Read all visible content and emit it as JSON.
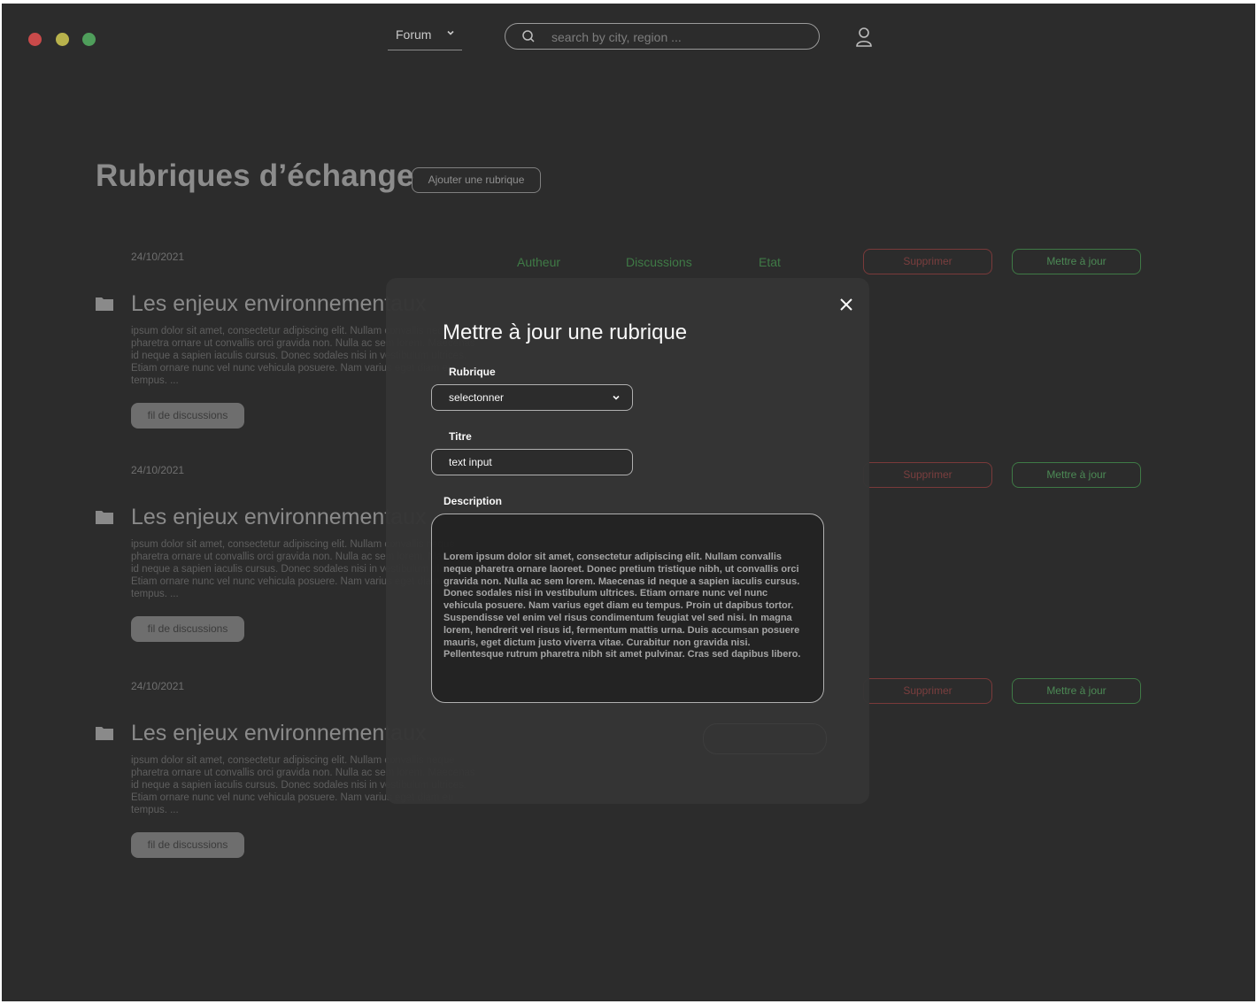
{
  "window": {
    "controls": [
      "close",
      "minimize",
      "maximize"
    ]
  },
  "nav": {
    "forum_label": "Forum",
    "search_placeholder": "search by city, region ...",
    "icons": {
      "search": "search-icon",
      "user": "user-icon",
      "chevron": "chevron-down-icon"
    }
  },
  "header": {
    "title": "Rubriques d’échange",
    "add_button": "Ajouter une rubrique"
  },
  "columns": {
    "author": "Autheur",
    "discussions": "Discussions",
    "state": "Etat"
  },
  "topics": [
    {
      "date": "24/10/2021",
      "title": "Les enjeux environnementaux",
      "description": "ipsum dolor sit amet, consectetur adipiscing elit. Nullam convallis neque pharetra ornare ut convallis orci gravida non. Nulla ac sem lorem. Maecenas id neque a sapien iaculis cursus. Donec sodales nisi in vestibulum ultrices. Etiam ornare nunc vel nunc vehicula posuere. Nam varius eget diam eu tempus. ...",
      "thread_button": "fil de discussions",
      "delete_button": "Supprimer",
      "update_button": "Mettre à jour"
    },
    {
      "date": "24/10/2021",
      "title": "Les enjeux environnementaux",
      "description": "ipsum dolor sit amet, consectetur adipiscing elit. Nullam convallis neque pharetra ornare ut convallis orci gravida non. Nulla ac sem lorem. Maecenas id neque a sapien iaculis cursus. Donec sodales nisi in vestibulum ultrices. Etiam ornare nunc vel nunc vehicula posuere. Nam varius eget diam eu tempus. ...",
      "thread_button": "fil de discussions",
      "delete_button": "Supprimer",
      "update_button": "Mettre à jour"
    },
    {
      "date": "24/10/2021",
      "title": "Les enjeux environnementaux",
      "description": "ipsum dolor sit amet, consectetur adipiscing elit. Nullam convallis neque pharetra ornare ut convallis orci gravida non. Nulla ac sem lorem. Maecenas id neque a sapien iaculis cursus. Donec sodales nisi in vestibulum ultrices. Etiam ornare nunc vel nunc vehicula posuere. Nam varius eget diam eu tempus. ...",
      "thread_button": "fil de discussions",
      "delete_button": "Supprimer",
      "update_button": "Mettre à jour"
    }
  ],
  "modal": {
    "title": "Mettre à jour une rubrique",
    "rubrique_label": "Rubrique",
    "rubrique_value": "selectonner",
    "titre_label": "Titre",
    "titre_value": "text input",
    "description_label": "Description",
    "description_value": "Lorem ipsum dolor sit amet, consectetur adipiscing elit. Nullam convallis neque pharetra ornare laoreet. Donec pretium tristique nibh, ut convallis orci gravida non. Nulla ac sem lorem. Maecenas id neque a sapien iaculis cursus. Donec sodales nisi in vestibulum ultrices. Etiam ornare nunc vel nunc vehicula posuere. Nam varius eget diam eu tempus. Proin ut dapibus tortor. Suspendisse vel enim vel risus condimentum feugiat vel sed nisi. In magna lorem, hendrerit vel risus id, fermentum mattis urna. Duis accumsan posuere mauris, eget dictum justo viverra vitae. Curabitur non gravida nisi. Pellentesque rutrum pharetra nibh sit amet pulvinar. Cras sed dapibus libero."
  },
  "colors": {
    "background": "#2c2c2c",
    "modal": "#353535",
    "danger": "#7a3a3a",
    "success": "#3f7a46",
    "window_red": "#c94a4a",
    "window_yellow": "#b8b24c",
    "window_green": "#4f9e5b"
  }
}
